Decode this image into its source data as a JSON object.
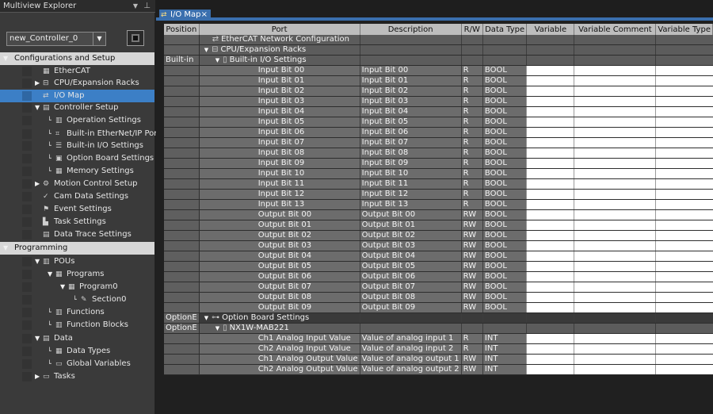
{
  "explorer": {
    "title": "Multiview Explorer",
    "controller": "new_Controller_0",
    "items": [
      {
        "label": "Configurations and Setup",
        "type": "header"
      },
      {
        "label": "EtherCAT",
        "icon": "ethercat-icon",
        "depth": 1
      },
      {
        "label": "CPU/Expansion Racks",
        "icon": "rack-icon",
        "depth": 1,
        "tri": "right"
      },
      {
        "label": "I/O Map",
        "icon": "io-map-icon",
        "depth": 1,
        "selected": true
      },
      {
        "label": "Controller Setup",
        "icon": "controller-setup-icon",
        "depth": 1,
        "tri": "down"
      },
      {
        "label": "Operation Settings",
        "icon": "operation-icon",
        "depth": 2
      },
      {
        "label": "Built-in EtherNet/IP Port",
        "icon": "ethernet-icon",
        "depth": 2
      },
      {
        "label": "Built-in I/O Settings",
        "icon": "io-settings-icon",
        "depth": 2
      },
      {
        "label": "Option Board Settings",
        "icon": "option-board-icon",
        "depth": 2
      },
      {
        "label": "Memory Settings",
        "icon": "memory-icon",
        "depth": 2
      },
      {
        "label": "Motion Control Setup",
        "icon": "motion-icon",
        "depth": 1,
        "tri": "right"
      },
      {
        "label": "Cam Data Settings",
        "icon": "cam-icon",
        "depth": 1
      },
      {
        "label": "Event Settings",
        "icon": "event-icon",
        "depth": 1
      },
      {
        "label": "Task Settings",
        "icon": "task-icon",
        "depth": 1
      },
      {
        "label": "Data Trace Settings",
        "icon": "trace-icon",
        "depth": 1
      },
      {
        "label": "Programming",
        "type": "header"
      },
      {
        "label": "POUs",
        "icon": "pou-icon",
        "depth": 1,
        "tri": "down"
      },
      {
        "label": "Programs",
        "icon": "programs-icon",
        "depth": 2,
        "tri": "down"
      },
      {
        "label": "Program0",
        "icon": "program-icon",
        "depth": 3,
        "tri": "down"
      },
      {
        "label": "Section0",
        "icon": "section-icon",
        "depth": 4
      },
      {
        "label": "Functions",
        "icon": "functions-icon",
        "depth": 2
      },
      {
        "label": "Function Blocks",
        "icon": "function-blocks-icon",
        "depth": 2
      },
      {
        "label": "Data",
        "icon": "data-icon",
        "depth": 1,
        "tri": "down"
      },
      {
        "label": "Data Types",
        "icon": "data-types-icon",
        "depth": 2
      },
      {
        "label": "Global Variables",
        "icon": "global-vars-icon",
        "depth": 2
      },
      {
        "label": "Tasks",
        "icon": "tasks-icon",
        "depth": 1,
        "tri": "right"
      }
    ]
  },
  "tab": {
    "label": "I/O Map",
    "close": "×"
  },
  "columns": [
    "Position",
    "Port",
    "Description",
    "R/W",
    "Data Type",
    "Variable",
    "Variable Comment",
    "Variable Type"
  ],
  "rows": [
    {
      "pos": "",
      "port": "EtherCAT Network Configuration",
      "indent": 0,
      "icon": "network-icon",
      "tri": "",
      "desc": "",
      "rw": "",
      "dt": "",
      "group": true
    },
    {
      "pos": "",
      "port": "CPU/Expansion Racks",
      "indent": 0,
      "icon": "rack-icon",
      "tri": "▼",
      "desc": "",
      "rw": "",
      "dt": "",
      "group": true
    },
    {
      "pos": "Built-in",
      "port": "Built-in I/O Settings",
      "indent": 1,
      "icon": "io-icon",
      "tri": "▼",
      "desc": "",
      "rw": "",
      "dt": "",
      "group": true
    },
    {
      "pos": "",
      "port": "Input Bit 00",
      "indent": 2,
      "desc": "Input Bit 00",
      "rw": "R",
      "dt": "BOOL"
    },
    {
      "pos": "",
      "port": "Input Bit 01",
      "indent": 2,
      "desc": "Input Bit 01",
      "rw": "R",
      "dt": "BOOL"
    },
    {
      "pos": "",
      "port": "Input Bit 02",
      "indent": 2,
      "desc": "Input Bit 02",
      "rw": "R",
      "dt": "BOOL"
    },
    {
      "pos": "",
      "port": "Input Bit 03",
      "indent": 2,
      "desc": "Input Bit 03",
      "rw": "R",
      "dt": "BOOL"
    },
    {
      "pos": "",
      "port": "Input Bit 04",
      "indent": 2,
      "desc": "Input Bit 04",
      "rw": "R",
      "dt": "BOOL"
    },
    {
      "pos": "",
      "port": "Input Bit 05",
      "indent": 2,
      "desc": "Input Bit 05",
      "rw": "R",
      "dt": "BOOL"
    },
    {
      "pos": "",
      "port": "Input Bit 06",
      "indent": 2,
      "desc": "Input Bit 06",
      "rw": "R",
      "dt": "BOOL"
    },
    {
      "pos": "",
      "port": "Input Bit 07",
      "indent": 2,
      "desc": "Input Bit 07",
      "rw": "R",
      "dt": "BOOL"
    },
    {
      "pos": "",
      "port": "Input Bit 08",
      "indent": 2,
      "desc": "Input Bit 08",
      "rw": "R",
      "dt": "BOOL"
    },
    {
      "pos": "",
      "port": "Input Bit 09",
      "indent": 2,
      "desc": "Input Bit 09",
      "rw": "R",
      "dt": "BOOL"
    },
    {
      "pos": "",
      "port": "Input Bit 10",
      "indent": 2,
      "desc": "Input Bit 10",
      "rw": "R",
      "dt": "BOOL"
    },
    {
      "pos": "",
      "port": "Input Bit 11",
      "indent": 2,
      "desc": "Input Bit 11",
      "rw": "R",
      "dt": "BOOL"
    },
    {
      "pos": "",
      "port": "Input Bit 12",
      "indent": 2,
      "desc": "Input Bit 12",
      "rw": "R",
      "dt": "BOOL"
    },
    {
      "pos": "",
      "port": "Input Bit 13",
      "indent": 2,
      "desc": "Input Bit 13",
      "rw": "R",
      "dt": "BOOL"
    },
    {
      "pos": "",
      "port": "Output Bit 00",
      "indent": 2,
      "desc": "Output Bit 00",
      "rw": "RW",
      "dt": "BOOL"
    },
    {
      "pos": "",
      "port": "Output Bit 01",
      "indent": 2,
      "desc": "Output Bit 01",
      "rw": "RW",
      "dt": "BOOL"
    },
    {
      "pos": "",
      "port": "Output Bit 02",
      "indent": 2,
      "desc": "Output Bit 02",
      "rw": "RW",
      "dt": "BOOL"
    },
    {
      "pos": "",
      "port": "Output Bit 03",
      "indent": 2,
      "desc": "Output Bit 03",
      "rw": "RW",
      "dt": "BOOL"
    },
    {
      "pos": "",
      "port": "Output Bit 04",
      "indent": 2,
      "desc": "Output Bit 04",
      "rw": "RW",
      "dt": "BOOL"
    },
    {
      "pos": "",
      "port": "Output Bit 05",
      "indent": 2,
      "desc": "Output Bit 05",
      "rw": "RW",
      "dt": "BOOL"
    },
    {
      "pos": "",
      "port": "Output Bit 06",
      "indent": 2,
      "desc": "Output Bit 06",
      "rw": "RW",
      "dt": "BOOL"
    },
    {
      "pos": "",
      "port": "Output Bit 07",
      "indent": 2,
      "desc": "Output Bit 07",
      "rw": "RW",
      "dt": "BOOL"
    },
    {
      "pos": "",
      "port": "Output Bit 08",
      "indent": 2,
      "desc": "Output Bit 08",
      "rw": "RW",
      "dt": "BOOL"
    },
    {
      "pos": "",
      "port": "Output Bit 09",
      "indent": 2,
      "desc": "Output Bit 09",
      "rw": "RW",
      "dt": "BOOL"
    },
    {
      "pos": "OptionE",
      "port": "Option Board Settings",
      "indent": 0,
      "icon": "option-board-icon",
      "tri": "▼",
      "desc": "",
      "rw": "",
      "dt": "",
      "group": true,
      "dark": true
    },
    {
      "pos": "OptionE",
      "port": "NX1W-MAB221",
      "indent": 1,
      "icon": "module-icon",
      "tri": "▼",
      "desc": "",
      "rw": "",
      "dt": "",
      "group": true
    },
    {
      "pos": "",
      "port": "Ch1 Analog Input Value",
      "indent": 2,
      "desc": "Value of analog input 1",
      "rw": "R",
      "dt": "INT"
    },
    {
      "pos": "",
      "port": "Ch2 Analog Input Value",
      "indent": 2,
      "desc": "Value of analog input 2",
      "rw": "R",
      "dt": "INT"
    },
    {
      "pos": "",
      "port": "Ch1 Analog Output Value",
      "indent": 2,
      "desc": "Value of analog output 1",
      "rw": "RW",
      "dt": "INT"
    },
    {
      "pos": "",
      "port": "Ch2 Analog Output Value",
      "indent": 2,
      "desc": "Value of analog output 2",
      "rw": "RW",
      "dt": "INT"
    }
  ]
}
